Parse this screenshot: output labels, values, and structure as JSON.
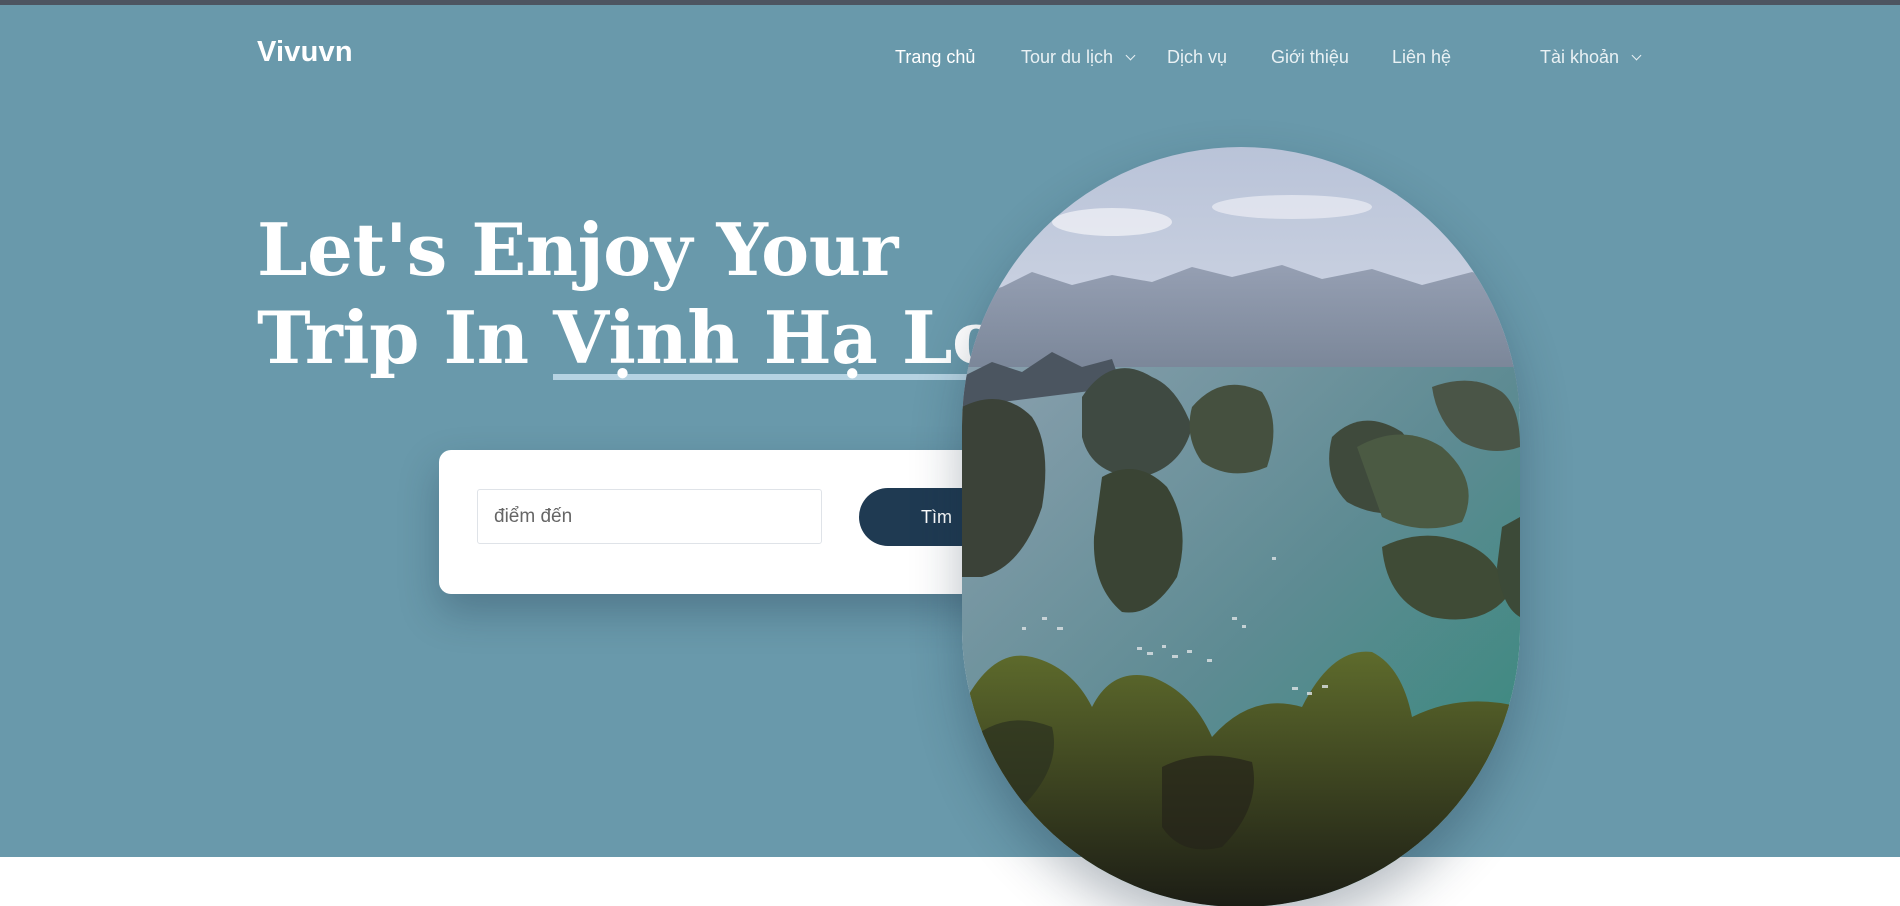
{
  "brand": {
    "name": "Vivuvn"
  },
  "nav": {
    "items": [
      {
        "label": "Trang chủ",
        "active": true
      },
      {
        "label": "Tour du lịch",
        "has_dropdown": true
      },
      {
        "label": "Dịch vụ"
      },
      {
        "label": "Giới thiệu"
      },
      {
        "label": "Liên hệ"
      }
    ],
    "account": {
      "label": "Tài khoản",
      "has_dropdown": true
    }
  },
  "hero": {
    "headline_line1": "Let's Enjoy Your",
    "headline_prefix": "Trip In ",
    "headline_highlight": "Vịnh Hạ Long.",
    "background_color": "#6999ab",
    "highlight_color": "#b6d3e2",
    "image_subject": "Ha Long Bay aerial view"
  },
  "search": {
    "placeholder": "điểm đến",
    "value": "",
    "button_label": "Tìm",
    "button_color": "#1f3a52"
  }
}
